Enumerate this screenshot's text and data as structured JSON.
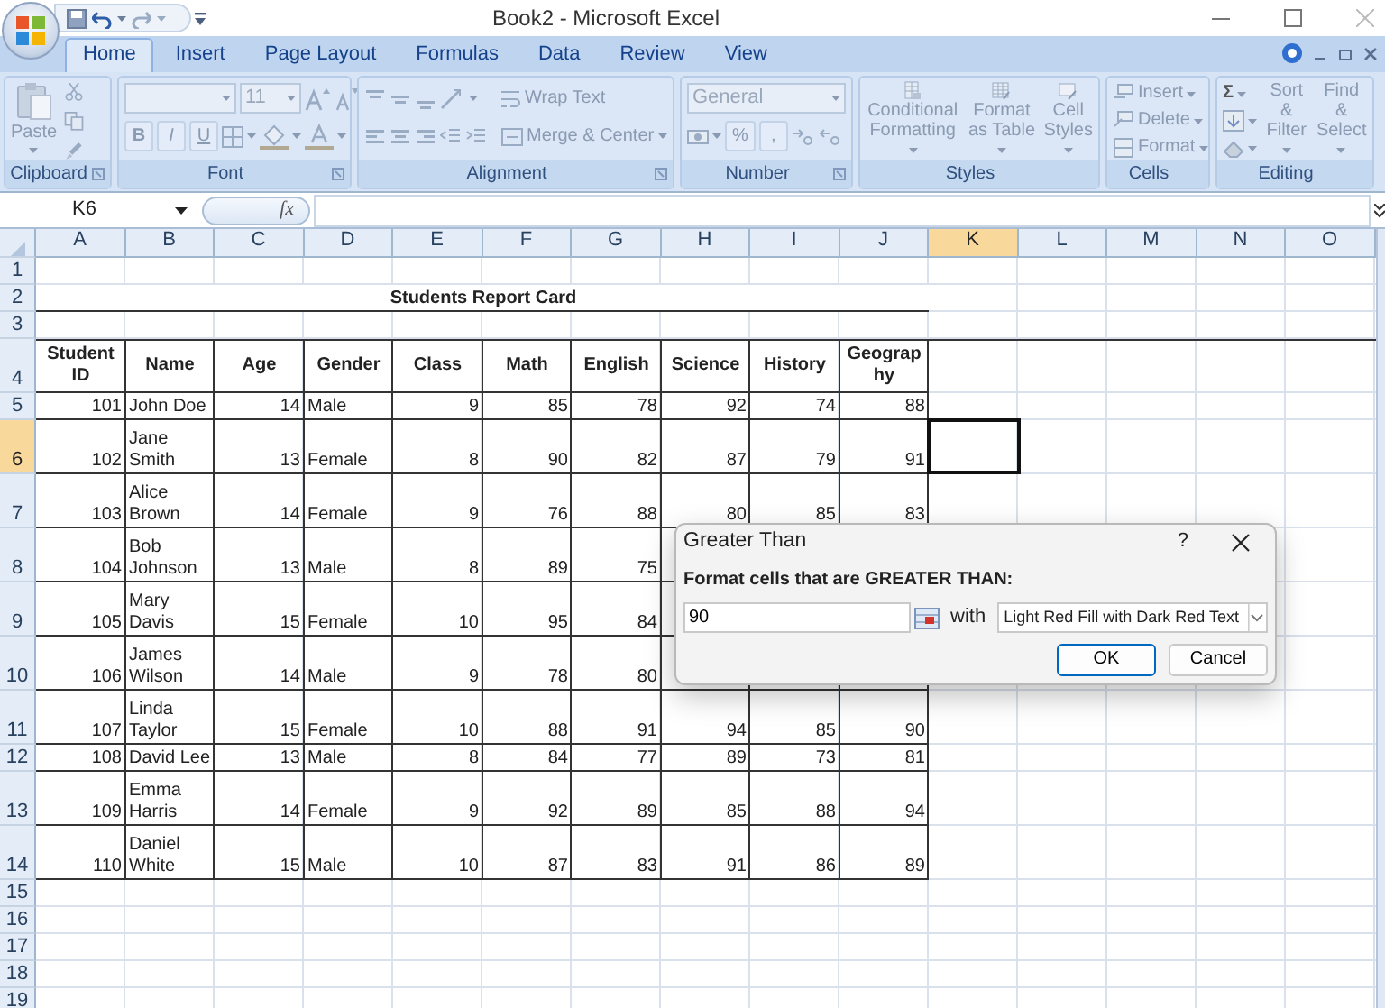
{
  "window": {
    "title": "Book2 - Microsoft Excel"
  },
  "ribbon": {
    "tabs": [
      {
        "label": "Home",
        "selected": true
      },
      {
        "label": "Insert",
        "selected": false
      },
      {
        "label": "Page Layout",
        "selected": false
      },
      {
        "label": "Formulas",
        "selected": false
      },
      {
        "label": "Data",
        "selected": false
      },
      {
        "label": "Review",
        "selected": false
      },
      {
        "label": "View",
        "selected": false
      }
    ],
    "groups": [
      {
        "kind": "clipboard",
        "label": "Clipboard",
        "paste": "Paste"
      },
      {
        "kind": "font",
        "label": "Font",
        "font_size": "11",
        "bold": "B",
        "italic": "I",
        "underline": "U"
      },
      {
        "kind": "alignment",
        "label": "Alignment",
        "wrap": "Wrap Text",
        "merge": "Merge & Center"
      },
      {
        "kind": "number",
        "label": "Number",
        "format": "General",
        "percent": "%",
        "comma": ","
      },
      {
        "kind": "styles",
        "label": "Styles",
        "buttons": [
          "Conditional Formatting",
          "Format as Table",
          "Cell Styles"
        ]
      },
      {
        "kind": "cells",
        "label": "Cells",
        "buttons": [
          "Insert",
          "Delete",
          "Format"
        ]
      },
      {
        "kind": "editing",
        "label": "Editing",
        "sum": "Σ",
        "buttons": [
          "Sort & Filter",
          "Find & Select"
        ]
      }
    ]
  },
  "formula_bar": {
    "name_box": "K6",
    "function_label": "fx"
  },
  "sheet": {
    "columns": [
      {
        "label": "A",
        "selected": false
      },
      {
        "label": "B",
        "selected": false
      },
      {
        "label": "C",
        "selected": false
      },
      {
        "label": "D",
        "selected": false
      },
      {
        "label": "E",
        "selected": false
      },
      {
        "label": "F",
        "selected": false
      },
      {
        "label": "G",
        "selected": false
      },
      {
        "label": "H",
        "selected": false
      },
      {
        "label": "I",
        "selected": false
      },
      {
        "label": "J",
        "selected": false
      },
      {
        "label": "K",
        "selected": true
      },
      {
        "label": "L",
        "selected": false
      },
      {
        "label": "M",
        "selected": false
      },
      {
        "label": "N",
        "selected": false
      },
      {
        "label": "O",
        "selected": false
      }
    ],
    "rows": [
      {
        "label": "1",
        "selected": false,
        "kind": "single"
      },
      {
        "label": "2",
        "selected": false,
        "kind": "title",
        "title": "Students Report Card"
      },
      {
        "label": "3",
        "selected": false,
        "kind": "single"
      },
      {
        "label": "4",
        "selected": false,
        "kind": "header",
        "cells": [
          "Student ID",
          "Name",
          "Age",
          "Gender",
          "Class",
          "Math",
          "English",
          "Science",
          "History",
          "Geography"
        ]
      },
      {
        "label": "5",
        "selected": false,
        "kind": "single",
        "cells": [
          "101",
          "John Doe",
          "14",
          "Male",
          "9",
          "85",
          "78",
          "92",
          "74",
          "88"
        ]
      },
      {
        "label": "6",
        "selected": true,
        "kind": "wrapped",
        "cells": [
          "102",
          "Jane Smith",
          "13",
          "Female",
          "8",
          "90",
          "82",
          "87",
          "79",
          "91"
        ]
      },
      {
        "label": "7",
        "selected": false,
        "kind": "wrapped",
        "cells": [
          "103",
          "Alice Brown",
          "14",
          "Female",
          "9",
          "76",
          "88",
          "80",
          "85",
          "83"
        ]
      },
      {
        "label": "8",
        "selected": false,
        "kind": "wrapped",
        "cells": [
          "104",
          "Bob Johnson",
          "13",
          "Male",
          "8",
          "89",
          "75",
          null,
          null,
          null
        ]
      },
      {
        "label": "9",
        "selected": false,
        "kind": "wrapped",
        "cells": [
          "105",
          "Mary Davis",
          "15",
          "Female",
          "10",
          "95",
          "84",
          null,
          null,
          null
        ]
      },
      {
        "label": "10",
        "selected": false,
        "kind": "wrapped",
        "cells": [
          "106",
          "James Wilson",
          "14",
          "Male",
          "9",
          "78",
          "80",
          null,
          null,
          null
        ]
      },
      {
        "label": "11",
        "selected": false,
        "kind": "wrapped",
        "cells": [
          "107",
          "Linda Taylor",
          "15",
          "Female",
          "10",
          "88",
          "91",
          "94",
          "85",
          "90"
        ]
      },
      {
        "label": "12",
        "selected": false,
        "kind": "single",
        "cells": [
          "108",
          "David Lee",
          "13",
          "Male",
          "8",
          "84",
          "77",
          "89",
          "73",
          "81"
        ]
      },
      {
        "label": "13",
        "selected": false,
        "kind": "wrapped",
        "cells": [
          "109",
          "Emma Harris",
          "14",
          "Female",
          "9",
          "92",
          "89",
          "85",
          "88",
          "94"
        ]
      },
      {
        "label": "14",
        "selected": false,
        "kind": "wrapped",
        "cells": [
          "110",
          "Daniel White",
          "15",
          "Male",
          "10",
          "87",
          "83",
          "91",
          "86",
          "89"
        ]
      },
      {
        "label": "15",
        "selected": false,
        "kind": "single"
      },
      {
        "label": "16",
        "selected": false,
        "kind": "single"
      },
      {
        "label": "17",
        "selected": false,
        "kind": "single"
      },
      {
        "label": "18",
        "selected": false,
        "kind": "single"
      },
      {
        "label": "19",
        "selected": false,
        "kind": "single"
      }
    ]
  },
  "dialog": {
    "title": "Greater Than",
    "help": "?",
    "prompt": "Format cells that are GREATER THAN:",
    "value": "90",
    "with_label": "with",
    "format": "Light Red Fill with Dark Red Text",
    "buttons": [
      {
        "label": "OK",
        "kind": "default"
      },
      {
        "label": "Cancel",
        "kind": "normal"
      }
    ]
  }
}
